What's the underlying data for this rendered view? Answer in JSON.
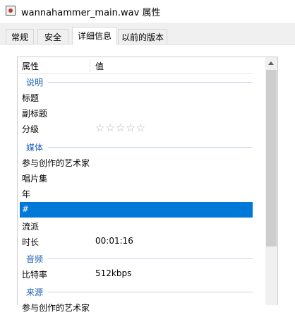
{
  "window": {
    "title": "wannahammer_main.wav 属性"
  },
  "tabs": [
    {
      "label": "常规"
    },
    {
      "label": "安全"
    },
    {
      "label": "详细信息"
    },
    {
      "label": "以前的版本"
    }
  ],
  "list": {
    "headers": {
      "name": "属性",
      "value": "值"
    },
    "groups": {
      "description": "说明",
      "media": "媒体",
      "audio": "音频",
      "source": "来源"
    },
    "rows": {
      "title": {
        "name": "标题",
        "value": ""
      },
      "subtitle": {
        "name": "副标题",
        "value": ""
      },
      "rating": {
        "name": "分级",
        "stars": "☆☆☆☆☆",
        "rating": 0,
        "max": 5
      },
      "artists": {
        "name": "参与创作的艺术家",
        "value": ""
      },
      "album": {
        "name": "唱片集",
        "value": ""
      },
      "year": {
        "name": "年",
        "value": ""
      },
      "track": {
        "name": "#",
        "value": ""
      },
      "genre": {
        "name": "流派",
        "value": ""
      },
      "duration": {
        "name": "时长",
        "value": "00:01:16"
      },
      "bitrate": {
        "name": "比特率",
        "value": "512kbps"
      },
      "partial": {
        "name": "参与创作的艺术家"
      }
    }
  },
  "colors": {
    "selection": "#0078d7",
    "group_text": "#1e5fb5"
  }
}
